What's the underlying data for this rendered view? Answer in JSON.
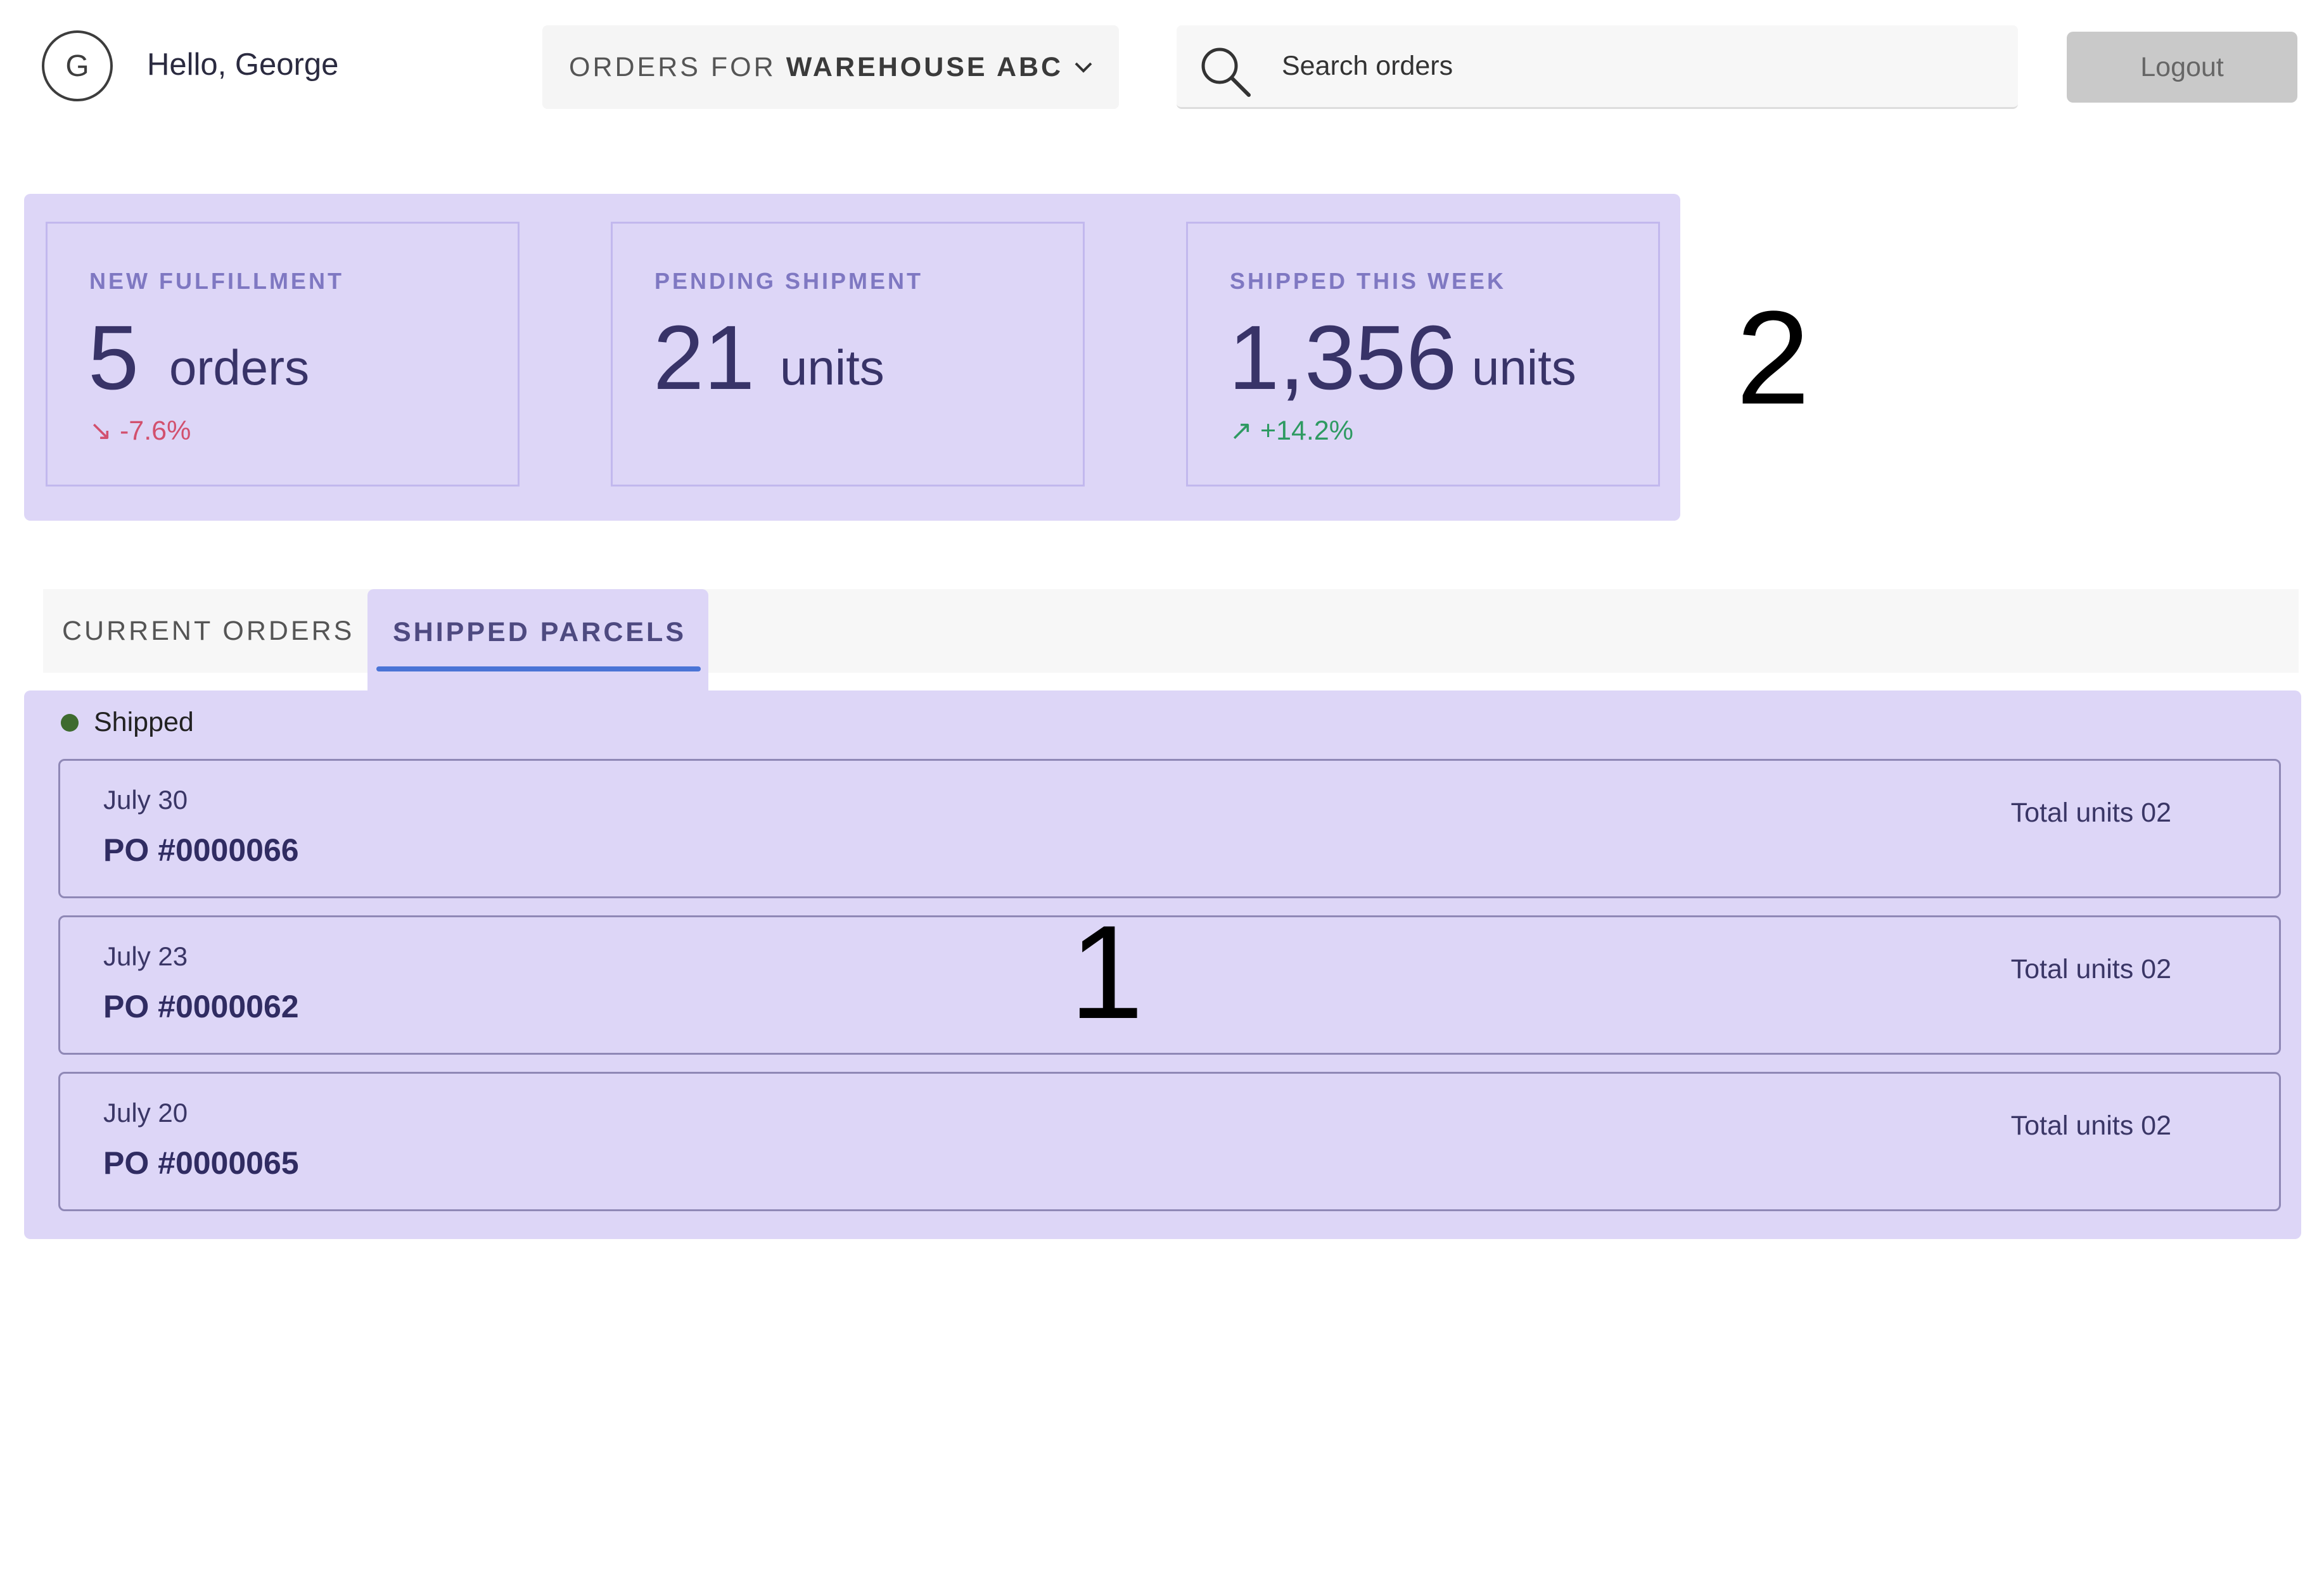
{
  "header": {
    "avatar_initial": "G",
    "greeting": "Hello, George",
    "warehouse_prefix": "ORDERS FOR",
    "warehouse_name": "WAREHOUSE ABC",
    "search_placeholder": "Search orders",
    "logout_label": "Logout"
  },
  "stats": [
    {
      "label": "NEW FULFILLMENT",
      "value": "5",
      "unit": "orders",
      "delta": "-7.6%",
      "delta_icon": "↘"
    },
    {
      "label": "PENDING SHIPMENT",
      "value": "21",
      "unit": "units"
    },
    {
      "label": "SHIPPED THIS WEEK",
      "value": "1,356",
      "unit": "units",
      "delta": "+14.2%",
      "delta_icon": "↗"
    }
  ],
  "markers": {
    "stats": "2",
    "orders": "1"
  },
  "tabs": [
    {
      "label": "CURRENT ORDERS",
      "active": false
    },
    {
      "label": "SHIPPED PARCELS",
      "active": true
    }
  ],
  "orders": {
    "status": "Shipped",
    "items": [
      {
        "date": "July 30",
        "po": "PO #0000066",
        "units": "Total units 02"
      },
      {
        "date": "July 23",
        "po": "PO #0000062",
        "units": "Total units 02"
      },
      {
        "date": "July 20",
        "po": "PO #0000065",
        "units": "Total units 02"
      }
    ]
  },
  "colors": {
    "panel": "#ddd6f7",
    "accent": "#4a74d6",
    "negative": "#d2506e",
    "positive": "#2e9a62",
    "status_dot": "#3e6b2f"
  }
}
